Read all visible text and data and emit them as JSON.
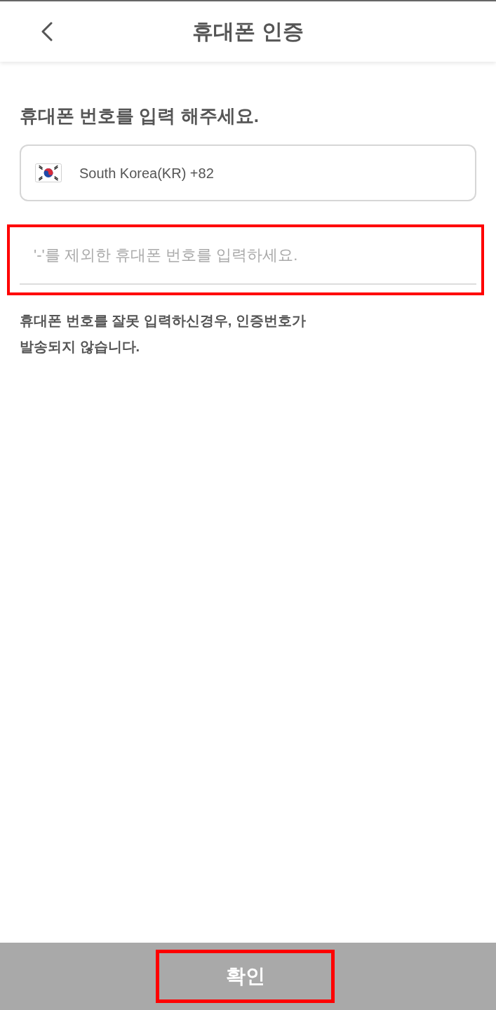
{
  "header": {
    "title": "휴대폰 인증"
  },
  "heading": "휴대폰 번호를 입력 해주세요.",
  "country_select": {
    "value": "South Korea(KR) +82"
  },
  "phone_input": {
    "placeholder": "'-'를 제외한 휴대폰 번호를 입력하세요.",
    "highlighted": true
  },
  "notice_lines": [
    "휴대폰 번호를 잘못 입력하신경우, 인증번호가",
    "발송되지 않습니다."
  ],
  "confirm_button": {
    "label": "확인",
    "highlighted": true
  }
}
